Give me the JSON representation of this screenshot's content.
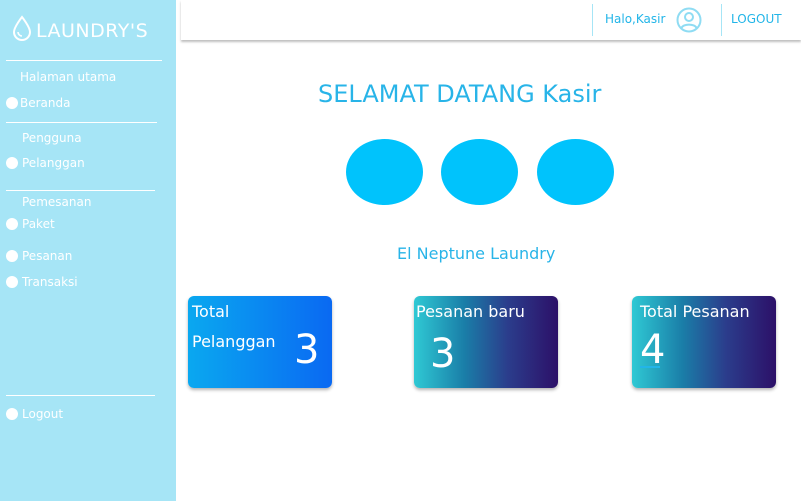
{
  "brand": {
    "name": "LAUNDRY'S"
  },
  "sidebar": {
    "sections": [
      {
        "label": "Halaman utama",
        "items": [
          {
            "label": "Beranda"
          }
        ]
      },
      {
        "label": "Pengguna",
        "items": [
          {
            "label": "Pelanggan"
          }
        ]
      },
      {
        "label": "Pemesanan",
        "items": [
          {
            "label": "Paket"
          },
          {
            "label": "Pesanan"
          },
          {
            "label": "Transaksi"
          }
        ]
      }
    ],
    "logout_label": "Logout"
  },
  "header": {
    "greeting": "Halo,Kasir",
    "logout_label": "LOGOUT",
    "user_icon": "user-circle-icon"
  },
  "main": {
    "title": "SELAMAT DATANG Kasir",
    "subtitle": "El Neptune Laundry",
    "stats": [
      {
        "label_line1": "Total",
        "label_line2": "Pelanggan",
        "value": "3"
      },
      {
        "label": "Pesanan baru",
        "value": "3"
      },
      {
        "label": "Total Pesanan",
        "value": "4"
      }
    ]
  },
  "colors": {
    "sidebar_bg": "#a6e5f6",
    "accent": "#28b4e8",
    "circle": "#00c3fc",
    "card_blue": "#0a69f2",
    "card_dark": "#2c1068"
  }
}
